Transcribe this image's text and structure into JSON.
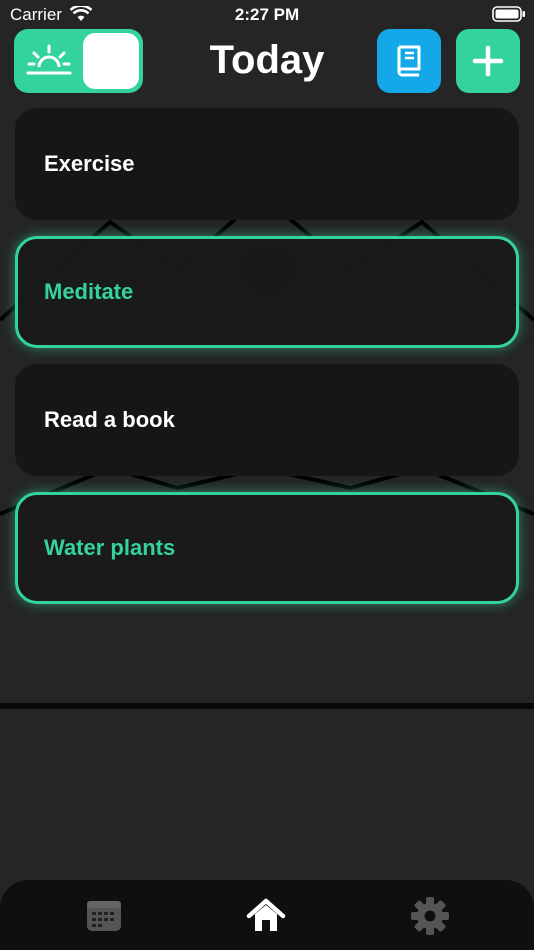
{
  "status_bar": {
    "carrier": "Carrier",
    "time": "2:27 PM"
  },
  "header": {
    "title": "Today",
    "mode_toggle_icon": "sunrise-icon",
    "journal_icon": "book-icon",
    "add_icon": "plus-icon"
  },
  "habits": [
    {
      "label": "Exercise",
      "completed": false
    },
    {
      "label": "Meditate",
      "completed": true
    },
    {
      "label": "Read a book",
      "completed": false
    },
    {
      "label": "Water plants",
      "completed": true
    }
  ],
  "tab_bar": {
    "tabs": [
      {
        "icon": "calendar-icon",
        "active": false
      },
      {
        "icon": "home-icon",
        "active": true
      },
      {
        "icon": "gear-icon",
        "active": false
      }
    ]
  },
  "colors": {
    "accent_green": "#34d39d",
    "accent_blue": "#14a8e8",
    "background": "#252525",
    "card": "#161616"
  }
}
